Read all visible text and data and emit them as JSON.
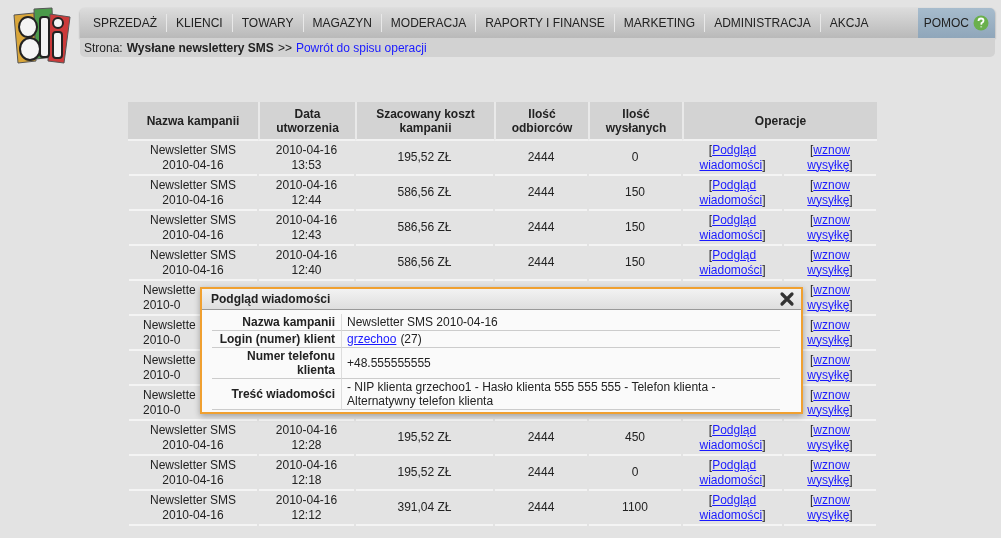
{
  "nav": [
    {
      "label": "SPRZEDAŻ",
      "kind": "menu"
    },
    {
      "label": "KLIENCI",
      "kind": "menu"
    },
    {
      "label": "TOWARY",
      "kind": "menu"
    },
    {
      "label": "MAGAZYN",
      "kind": "menu"
    },
    {
      "label": "MODERACJA",
      "kind": "menu"
    },
    {
      "label": "RAPORTY I FINANSE",
      "kind": "menu"
    },
    {
      "label": "MARKETING",
      "kind": "menu"
    },
    {
      "label": "ADMINISTRACJA",
      "kind": "menu"
    },
    {
      "label": "AKCJA",
      "kind": "menu"
    },
    {
      "label": "POMOC",
      "kind": "help"
    }
  ],
  "breadcrumb": {
    "prefix": "Strona:",
    "page": "Wysłane newslettery SMS",
    "separator": ">>",
    "link": "Powrót do spisu operacji"
  },
  "table": {
    "columns": [
      "Nazwa kampanii",
      "Data utworzenia",
      "Szacowany koszt kampanii",
      "Ilość odbiorców",
      "Ilość wysłanych",
      "Operacje"
    ],
    "rows": [
      {
        "kind": "full",
        "name": "Newsletter SMS 2010-04-16",
        "created": "2010-04-16 13:53",
        "cost": "195,52 ZŁ",
        "recipients": "2444",
        "sent": "0",
        "preview": {
          "open": "[",
          "label": "Podgląd wiadomości",
          "close": "]"
        },
        "resume": {
          "open": "[",
          "label": "wznow wysyłkę",
          "close": "]"
        }
      },
      {
        "kind": "full",
        "name": "Newsletter SMS 2010-04-16",
        "created": "2010-04-16 12:44",
        "cost": "586,56 ZŁ",
        "recipients": "2444",
        "sent": "150",
        "preview": {
          "open": "[",
          "label": "Podgląd wiadomości",
          "close": "]"
        },
        "resume": {
          "open": "[",
          "label": "wznow wysyłkę",
          "close": "]"
        }
      },
      {
        "kind": "full",
        "name": "Newsletter SMS 2010-04-16",
        "created": "2010-04-16 12:43",
        "cost": "586,56 ZŁ",
        "recipients": "2444",
        "sent": "150",
        "preview": {
          "open": "[",
          "label": "Podgląd wiadomości",
          "close": "]"
        },
        "resume": {
          "open": "[",
          "label": "wznow wysyłkę",
          "close": "]"
        }
      },
      {
        "kind": "full",
        "name": "Newsletter SMS 2010-04-16",
        "created": "2010-04-16 12:40",
        "cost": "586,56 ZŁ",
        "recipients": "2444",
        "sent": "150",
        "preview": {
          "open": "[",
          "label": "Podgląd wiadomości",
          "close": "]"
        },
        "resume": {
          "open": "[",
          "label": "wznow wysyłkę",
          "close": "]"
        }
      },
      {
        "kind": "covered",
        "name_lines": [
          "Newslette",
          "2010-0"
        ],
        "resume": {
          "open": "[",
          "label": "wznow wysyłkę",
          "close": "]"
        }
      },
      {
        "kind": "covered",
        "name_lines": [
          "Newslette",
          "2010-0"
        ],
        "resume": {
          "open": "[",
          "label": "wznow wysyłkę",
          "close": "]"
        }
      },
      {
        "kind": "covered",
        "name_lines": [
          "Newslette",
          "2010-0"
        ],
        "resume": {
          "open": "[",
          "label": "wznow wysyłkę",
          "close": "]"
        }
      },
      {
        "kind": "covered",
        "name_lines": [
          "Newslette",
          "2010-0"
        ],
        "resume": {
          "open": "[",
          "label": "wznow wysyłkę",
          "close": "]"
        }
      },
      {
        "kind": "full",
        "name": "Newsletter SMS 2010-04-16",
        "created": "2010-04-16 12:28",
        "cost": "195,52 ZŁ",
        "recipients": "2444",
        "sent": "450",
        "preview": {
          "open": "[",
          "label": "Podgląd wiadomości",
          "close": "]"
        },
        "resume": {
          "open": "[",
          "label": "wznow wysyłkę",
          "close": "]"
        }
      },
      {
        "kind": "full",
        "name": "Newsletter SMS 2010-04-16",
        "created": "2010-04-16 12:18",
        "cost": "195,52 ZŁ",
        "recipients": "2444",
        "sent": "0",
        "preview": {
          "open": "[",
          "label": "Podgląd wiadomości",
          "close": "]"
        },
        "resume": {
          "open": "[",
          "label": "wznow wysyłkę",
          "close": "]"
        }
      },
      {
        "kind": "full",
        "name": "Newsletter SMS 2010-04-16",
        "created": "2010-04-16 12:12",
        "cost": "391,04 ZŁ",
        "recipients": "2444",
        "sent": "1100",
        "preview": {
          "open": "[",
          "label": "Podgląd wiadomości",
          "close": "]"
        },
        "resume": {
          "open": "[",
          "label": "wznow wysyłkę",
          "close": "]"
        }
      }
    ]
  },
  "dialog": {
    "title": "Podgląd wiadomości",
    "fields": [
      {
        "label": "Nazwa kampanii",
        "kind": "text",
        "value": "Newsletter SMS 2010-04-16"
      },
      {
        "label": "Login (numer) klient",
        "kind": "link",
        "link": "grzechoo",
        "suffix": "(27)"
      },
      {
        "label": "Numer telefonu klienta",
        "kind": "text",
        "value": "+48.555555555"
      },
      {
        "label": "Treść wiadomości",
        "kind": "text",
        "value": "- NIP klienta grzechoo1 - Hasło klienta 555 555 555 - Telefon klienta - Alternatywny telefon klienta"
      }
    ]
  }
}
